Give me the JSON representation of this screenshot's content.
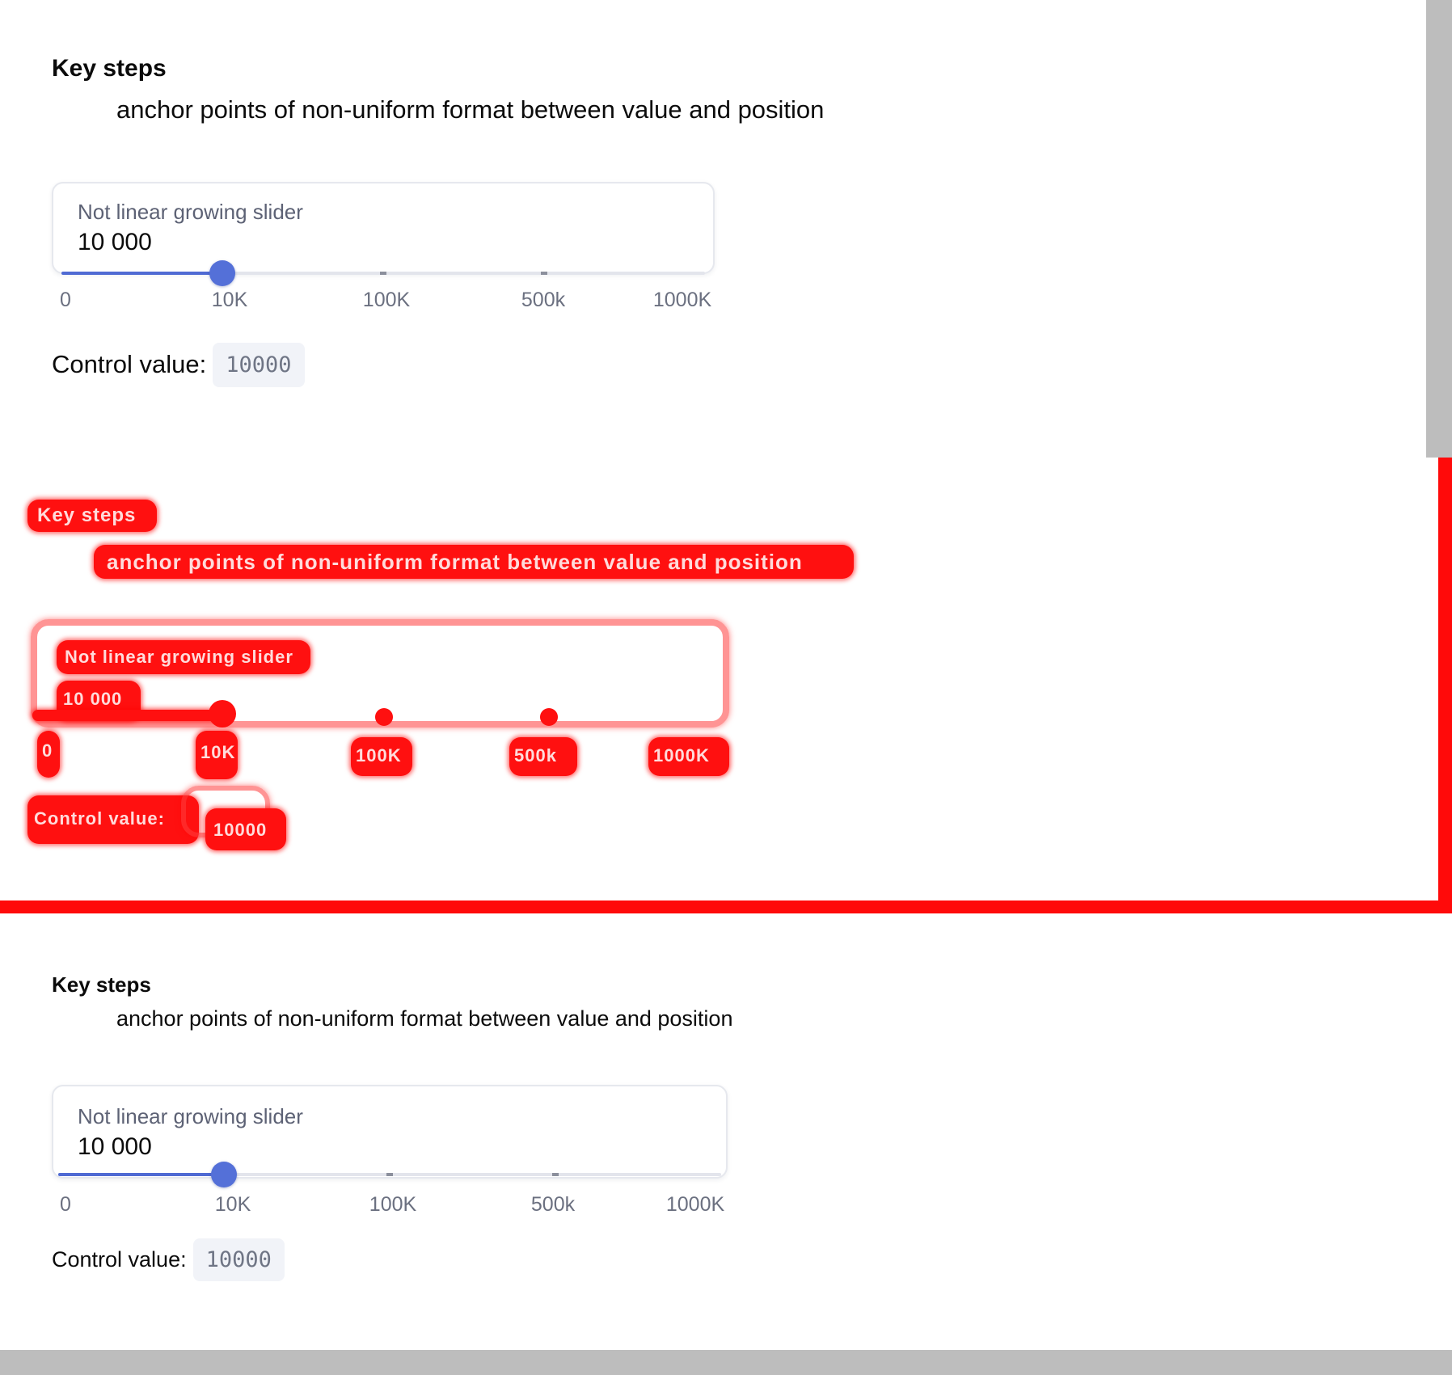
{
  "colors": {
    "accent": "#5470d8",
    "track": "#e3e5ec",
    "markup_red": "#ff1010",
    "background_strip": "#bdbdbd"
  },
  "top_demo": {
    "title": "Key steps",
    "description": "anchor points of non-uniform format between value and position",
    "slider": {
      "label": "Not linear growing slider",
      "value_display": "10 000",
      "value_fraction": 0.25,
      "tick_labels": [
        "0",
        "10K",
        "100K",
        "500k",
        "1000K"
      ]
    },
    "control": {
      "label": "Control value:",
      "value": "10000"
    }
  },
  "bottom_demo": {
    "title": "Key steps",
    "description": "anchor points of non-uniform format between value and position",
    "slider": {
      "label": "Not linear growing slider",
      "value_display": "10 000",
      "value_fraction": 0.25,
      "tick_labels": [
        "0",
        "10K",
        "100K",
        "500k",
        "1000K"
      ]
    },
    "control": {
      "label": "Control value:",
      "value": "10000"
    }
  }
}
